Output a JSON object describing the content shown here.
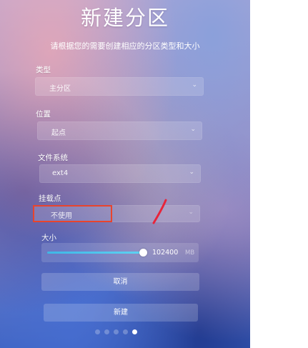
{
  "header": {
    "title": "新建分区",
    "subtitle": "请根据您的需要创建相应的分区类型和大小"
  },
  "form": {
    "type": {
      "label": "类型",
      "value": "主分区"
    },
    "location": {
      "label": "位置",
      "value": "起点"
    },
    "filesystem": {
      "label": "文件系统",
      "value": "ext4"
    },
    "mountpoint": {
      "label": "挂载点",
      "value": "不使用"
    },
    "size": {
      "label": "大小",
      "value": "102400",
      "unit": "MB",
      "level": 0.6
    }
  },
  "buttons": {
    "cancel": "取消",
    "create": "新建"
  },
  "pager": {
    "count": 5,
    "active_index": 4
  },
  "colors": {
    "highlight_box": "#e8442d",
    "annotation_mark": "#e8243a",
    "slider_accent": "#3fb7e6"
  },
  "icons": {
    "dropdown": "chevron-down-icon"
  }
}
